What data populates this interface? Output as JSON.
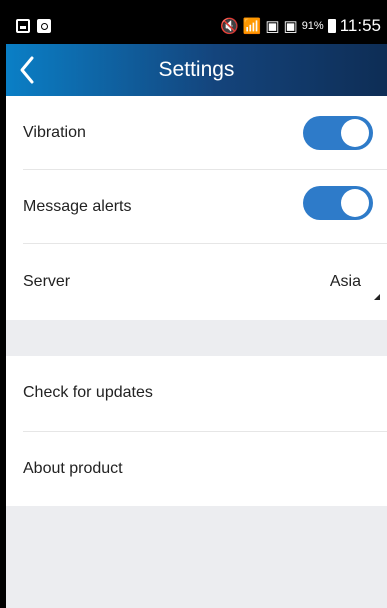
{
  "status_bar": {
    "left_icons": [
      "photo-icon",
      "search-icon"
    ],
    "right_icons": [
      "mute-icon",
      "wifi-icon",
      "sim-no-signal-icon",
      "sim-no-signal-icon"
    ],
    "battery": "91%",
    "time": "11:55"
  },
  "header": {
    "title": "Settings",
    "back_icon": "chevron-left-icon",
    "gradient": [
      "#0a7fc6",
      "#14447c",
      "#0e2d55"
    ]
  },
  "settings": {
    "vibration": {
      "label": "Vibration",
      "enabled": true
    },
    "message_alerts": {
      "label": "Message alerts",
      "enabled": true
    },
    "server": {
      "label": "Server",
      "value": "Asia"
    },
    "check_updates": {
      "label": "Check for updates"
    },
    "about": {
      "label": "About product"
    }
  },
  "colors": {
    "toggle_on": "#2e7bc9",
    "background": "#ecedf0",
    "row": "#ffffff",
    "text": "#222222"
  }
}
